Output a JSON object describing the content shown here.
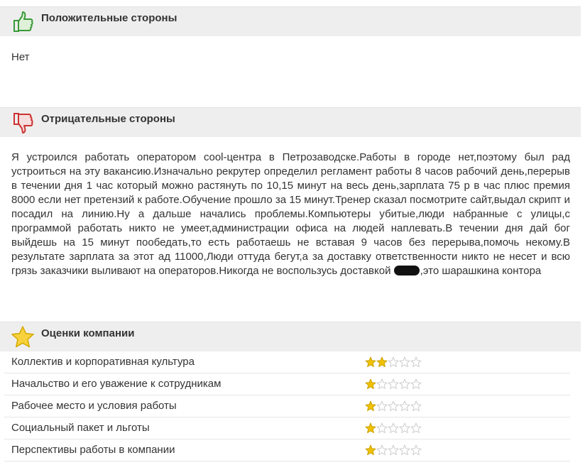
{
  "pros": {
    "title": "Положительные стороны",
    "icon": "thumbs-up-icon",
    "text": "Нет"
  },
  "cons": {
    "title": "Отрицательные стороны",
    "icon": "thumbs-down-icon",
    "text_before": "Я устроился работать оператором cool-центра в Петрозаводске.Работы в городе нет,поэтому был рад устроиться на эту вакансию.Изначально рекрутер определил регламент работы 8 часов рабочий день,перерыв в течении дня 1 час который можно растянуть по 10,15 минут на весь день,зарплата 75 р в час плюс премия 8000 если нет претензий к работе.Обучение прошло за 15 минут.Тренер сказал посмотрите сайт,выдал скрипт и посадил на линию.Ну а дальше начались проблемы.Компьютеры убитые,люди набранные с улицы,с программой работать никто не умеет,администрации офиса на людей наплевать.В течении дня дай бог выйдешь на 15 минут пообедать,то есть работаешь не вставая 9 часов без перерыва,помочь некому.В результате зарплата за этот ад 11000,Люди оттуда бегут,а за доставку ответственности никто не несет и всю грязь заказчики выливают на операторов.Никогда не воспользусь доставкой ",
    "text_after": ",это шарашкина контора"
  },
  "ratings": {
    "title": "Оценки компании",
    "icon": "star-icon",
    "max_stars": 5,
    "items": [
      {
        "label": "Коллектив и корпоративная культура",
        "stars": 2
      },
      {
        "label": "Начальство и его уважение к сотрудникам",
        "stars": 1
      },
      {
        "label": "Рабочее место и условия работы",
        "stars": 1
      },
      {
        "label": "Социальный пакет и льготы",
        "stars": 1
      },
      {
        "label": "Перспективы работы в компании",
        "stars": 1
      }
    ]
  },
  "colors": {
    "header_bg": "#eeeeee",
    "thumbs_up": "#3a9a3a",
    "thumbs_down": "#cc3333",
    "star_filled": "#f2c200",
    "star_empty": "#cccccc"
  }
}
